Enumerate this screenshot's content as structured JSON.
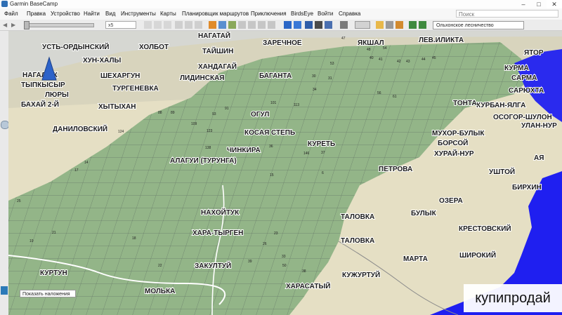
{
  "window": {
    "title": "Garmin BaseCamp",
    "minimize": "–",
    "maximize": "□",
    "close": "✕"
  },
  "menu": [
    "Файл",
    "Правка",
    "Устройство",
    "Найти",
    "Вид",
    "Инструменты",
    "Карты",
    "Планировщик маршрутов",
    "Приключения",
    "BirdsEye",
    "Войти",
    "Справка"
  ],
  "search": {
    "placeholder": "Поиск"
  },
  "toolbar": {
    "zoom_value": "x5",
    "map_layer": "Ольхонское лесничество"
  },
  "map": {
    "places": [
      "УСТЬ-ОРДЫНСКИЙ",
      "ХОЛБОТ",
      "НАГАТАЙ",
      "ЗАРЕЧНОЕ",
      "ТАЙШИН",
      "ЯКШАЛ",
      "ЛЕВ.ИЛИКТА",
      "ЯТОР",
      "ХУН-ХАЛЫ",
      "ХАНДАГАЙ",
      "КУРМА",
      "НАГАЛЫК",
      "ШЕХАРГУН",
      "ЛИДИНСКАЯ",
      "БАГАНТА",
      "САРМА",
      "ТЫПКЫСЫР",
      "ТУРГЕНЕВКА",
      "САРЮХТА",
      "ЛЮРЫ",
      "БАХАЙ 2-Й",
      "ХЫТЫХАН",
      "ОГУЛ",
      "КУРБАН-ЯЛГА",
      "ТОНТА",
      "ОСОГОР-ШУЛОН",
      "ДАНИЛОВСКИЙ",
      "КОСАЯ СТЕПЬ",
      "МУХОР-БУЛЫК",
      "УЛАН-НУР",
      "БОРСОЙ",
      "КУРЕТЬ",
      "ЧИНКИРА",
      "ХУРАЙ-НУР",
      "АЯ",
      "АЛАГУИ (ТУРУНГА)",
      "ПЕТРОВА",
      "УШТОЙ",
      "БИРХИН",
      "ОЗЕРА",
      "НАХОЙТУК",
      "БУЛЫК",
      "ТАЛОВКА",
      "ХАРА-ТЫРГЕН",
      "КРЕСТОВСКИЙ",
      "ТАЛОВКА",
      "МАРТА",
      "ШИРОКИЙ",
      "ЗАКУЛТУЙ",
      "КУРТУН",
      "КУЖУРТУЙ",
      "МОЛЬКА",
      "ХАРАСАТЫЙ"
    ],
    "parcel_numbers": [
      "47",
      "54",
      "40",
      "41",
      "42",
      "43",
      "44",
      "45",
      "48",
      "53",
      "30",
      "31",
      "34",
      "56",
      "61",
      "101",
      "113",
      "88",
      "89",
      "91",
      "93",
      "109",
      "123",
      "138",
      "36",
      "37",
      "124",
      "146",
      "6",
      "15",
      "14",
      "17",
      "25",
      "21",
      "19",
      "18",
      "22",
      "23",
      "26",
      "33",
      "38",
      "39",
      "50"
    ],
    "overlay_select": "Показать наложения"
  },
  "watermark": "купипродай",
  "colors": {
    "forest": "#93b588",
    "steppe": "#e2dcc0",
    "water": "#1f1ff0"
  }
}
